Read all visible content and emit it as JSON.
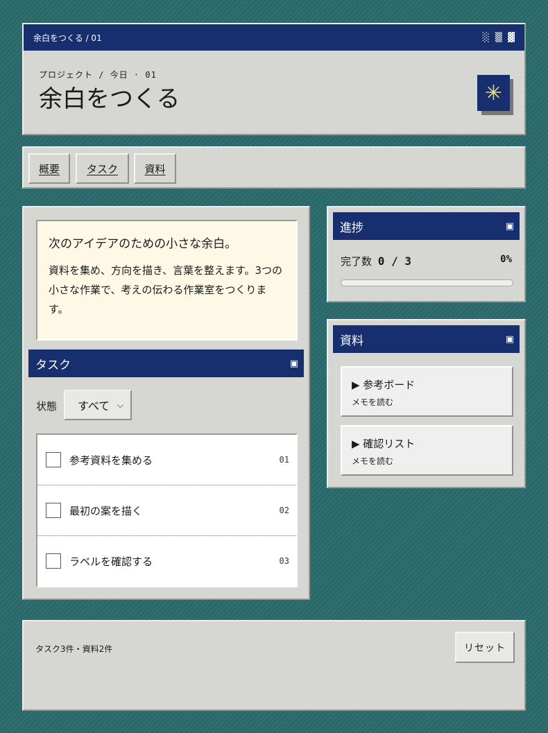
{
  "header": {
    "crumb": "余白をつくる / 01",
    "pattern": "░ ▒ ▓",
    "eyebrow": "プロジェクト / 今日 · 01",
    "title": "余白をつくる",
    "logo_glyph": "✳"
  },
  "tabs": [
    {
      "label": "概要"
    },
    {
      "label": "タスク"
    },
    {
      "label": "資料"
    }
  ],
  "intro": {
    "heading": "次のアイデアのための小さな余白。",
    "body": "資料を集め、方向を描き、言葉を整えます。3つの小さな作業で、考えの伝わる作業室をつくります。"
  },
  "tasks": {
    "title": "タスク",
    "bar_icon": "▣",
    "filter_label": "状態",
    "filter_value": "すべて",
    "items": [
      {
        "label": "参考資料を集める",
        "num": "01",
        "done": false
      },
      {
        "label": "最初の案を描く",
        "num": "02",
        "done": false
      },
      {
        "label": "ラベルを確認する",
        "num": "03",
        "done": false
      }
    ]
  },
  "progress": {
    "title": "進捗",
    "bar_icon": "▣",
    "label": "完了数",
    "count": "0 / 3",
    "percent_text": "0%",
    "fraction": 0
  },
  "resources": {
    "title": "資料",
    "bar_icon": "▣",
    "items": [
      {
        "title": "▶ 参考ボード",
        "sub": "メモを読む"
      },
      {
        "title": "▶ 確認リスト",
        "sub": "メモを読む"
      }
    ]
  },
  "footer": {
    "summary": "タスク3件・資料2件",
    "reset_label": "リセット"
  },
  "colors": {
    "background": "#2f6f72",
    "accent": "#172f6e",
    "panel": "#d6d6d2",
    "intro_bg": "#fdf9e6",
    "logo_glyph": "#f2e27a"
  }
}
